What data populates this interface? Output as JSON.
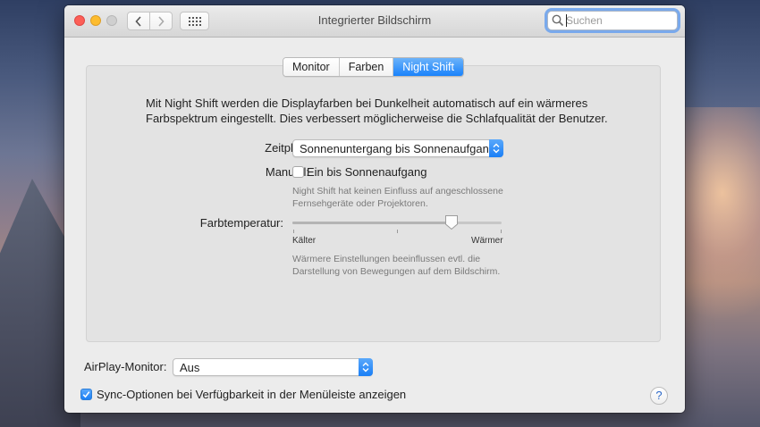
{
  "window": {
    "title": "Integrierter Bildschirm",
    "search": {
      "value": "",
      "placeholder": "Suchen"
    }
  },
  "tabs": [
    {
      "label": "Monitor",
      "selected": false
    },
    {
      "label": "Farben",
      "selected": false
    },
    {
      "label": "Night Shift",
      "selected": true
    }
  ],
  "night_shift": {
    "intro": "Mit Night Shift werden die Displayfarben bei Dunkelheit automatisch auf ein wärmeres Farbspektrum eingestellt. Dies verbessert möglicherweise die Schlafqualität der Benutzer.",
    "schedule_label": "Zeitplan:",
    "schedule_value": "Sonnenuntergang bis Sonnenaufgang",
    "manual_label": "Manuell:",
    "manual_checkbox_label": "Ein bis Sonnenaufgang",
    "manual_checked": false,
    "manual_note": "Night Shift hat keinen Einfluss auf angeschlossene Fernsehgeräte oder Projektoren.",
    "temperature_label": "Farbtemperatur:",
    "temperature_min_label": "Kälter",
    "temperature_max_label": "Wärmer",
    "temperature_level": 0.76,
    "temperature_note": "Wärmere Einstellungen beeinflussen evtl. die Darstellung von Bewegungen auf dem Bildschirm."
  },
  "footer": {
    "airplay_label": "AirPlay-Monitor:",
    "airplay_value": "Aus",
    "sync_label": "Sync-Optionen bei Verfügbarkeit in der Menüleiste anzeigen",
    "sync_checked": true,
    "help_label": "?"
  },
  "colors": {
    "accent": "#1a82fb",
    "close": "#fc5f57",
    "minimize": "#fdbc2e"
  }
}
